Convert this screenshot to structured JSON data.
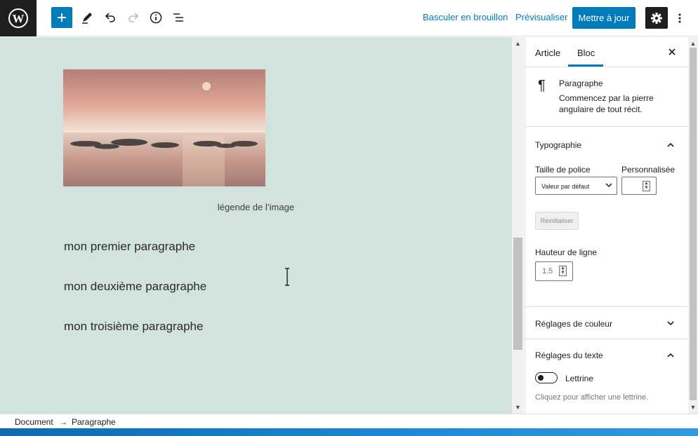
{
  "toolbar": {
    "switch_draft": "Basculer en brouillon",
    "preview": "Prévisualiser",
    "update": "Mettre à jour"
  },
  "editor": {
    "caption": "légende de l’image",
    "paragraphs": [
      "mon premier paragraphe",
      "mon deuxième paragraphe",
      "mon troisième paragraphe"
    ]
  },
  "sidebar": {
    "tabs": {
      "article": "Article",
      "bloc": "Bloc"
    },
    "block": {
      "title": "Paragraphe",
      "description": "Commencez par la pierre angulaire de tout récit."
    },
    "typography": {
      "title": "Typographie",
      "font_size_label": "Taille de police",
      "custom_label": "Personnalisée",
      "font_size_value": "Valeur par défaut",
      "reset": "Réinitialiser",
      "line_height_label": "Hauteur de ligne",
      "line_height_value": "1.5"
    },
    "color": {
      "title": "Réglages de couleur"
    },
    "text": {
      "title": "Réglages du texte",
      "dropcap_label": "Lettrine",
      "dropcap_hint": "Cliquez pour afficher une lettrine."
    }
  },
  "footer": {
    "crumb_document": "Document",
    "crumb_sep": "→",
    "crumb_block": "Paragraphe"
  },
  "colors": {
    "accent": "#007cba",
    "canvas_bg": "#d2e3de",
    "dark": "#1e1e1e"
  }
}
